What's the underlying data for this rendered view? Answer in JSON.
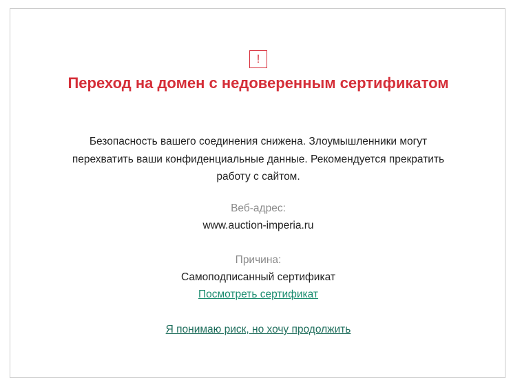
{
  "warning": {
    "icon": "exclamation-icon",
    "icon_glyph": "!",
    "title": "Переход на домен с недоверенным сертификатом",
    "description": "Безопасность вашего соединения снижена. Злоумышленники могут перехватить ваши конфиденциальные данные. Рекомендуется прекратить работу с сайтом."
  },
  "details": {
    "address_label": "Веб-адрес:",
    "address_value": "www.auction-imperia.ru",
    "reason_label": "Причина:",
    "reason_value": "Самоподписанный сертификат",
    "view_certificate_link": "Посмотреть сертификат"
  },
  "actions": {
    "continue_link": "Я понимаю риск, но хочу продолжить"
  },
  "colors": {
    "accent_red": "#d52f39",
    "link_green": "#1b8c6f",
    "label_gray": "#8a8a8a"
  }
}
